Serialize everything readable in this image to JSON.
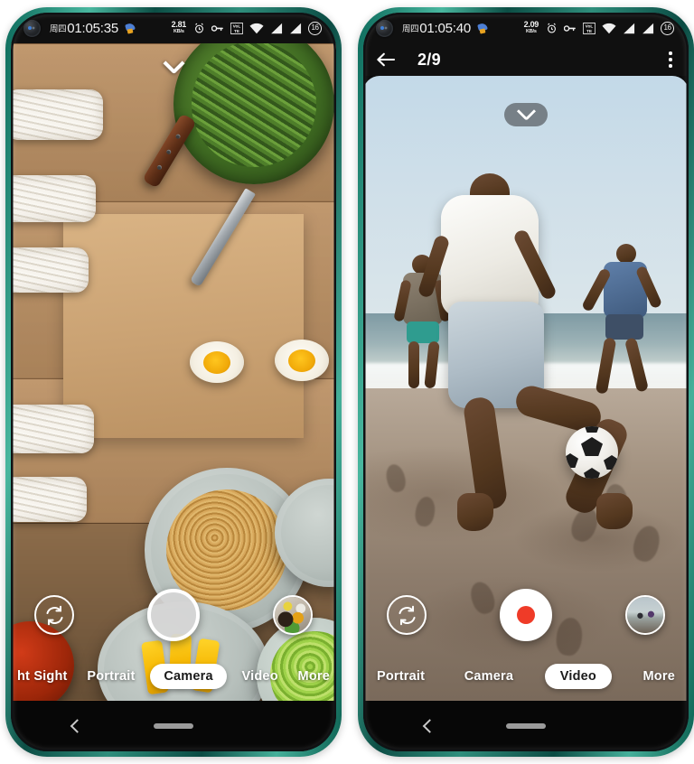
{
  "phones": {
    "left": {
      "status_bar": {
        "day": "周四",
        "time": "01:05:35",
        "app_icon": "bird-app-icon",
        "net_speed_value": "2.81",
        "net_speed_unit": "KB/s",
        "icons": [
          "alarm-icon",
          "key-icon",
          "volte-icon",
          "wifi-icon",
          "signal-1-icon",
          "signal-2-icon"
        ],
        "battery_level": "16"
      },
      "viewfinder": {
        "scene_description": "noodle-and-food-flatlay",
        "expand_button": "chevron-down-icon"
      },
      "controls": {
        "flip_camera": "camera-flip-icon",
        "shutter": "photo-shutter-button",
        "thumbnail": "gallery-thumbnail-spices"
      },
      "modes": [
        {
          "label": "ht Sight",
          "active": false
        },
        {
          "label": "Portrait",
          "active": false
        },
        {
          "label": "Camera",
          "active": true
        },
        {
          "label": "Video",
          "active": false
        },
        {
          "label": "More",
          "active": false
        }
      ],
      "navbar": {
        "back": "back-chevron-icon",
        "home": "home-pill-icon"
      }
    },
    "right": {
      "status_bar": {
        "day": "周四",
        "time": "01:05:40",
        "app_icon": "bird-app-icon",
        "net_speed_value": "2.09",
        "net_speed_unit": "KB/s",
        "icons": [
          "alarm-icon",
          "key-icon",
          "volte-icon",
          "wifi-icon",
          "signal-1-icon",
          "signal-2-icon"
        ],
        "battery_level": "16"
      },
      "header": {
        "back_icon": "back-arrow-icon",
        "title": "2/9",
        "menu_icon": "overflow-menu-icon"
      },
      "viewfinder": {
        "scene_description": "beach-football-players",
        "expand_button": "chevron-down-icon"
      },
      "controls": {
        "flip_camera": "camera-flip-icon",
        "shutter": "video-record-button",
        "thumbnail": "gallery-thumbnail-beach"
      },
      "modes": [
        {
          "label": "Portrait",
          "active": false
        },
        {
          "label": "Camera",
          "active": false
        },
        {
          "label": "Video",
          "active": true
        },
        {
          "label": "More",
          "active": false
        }
      ],
      "navbar": {
        "back": "back-chevron-icon",
        "home": "home-pill-icon"
      }
    }
  },
  "colors": {
    "frame": "#1f7f6c",
    "record_red": "#ef3b28",
    "active_pill": "#ffffff",
    "status_bg": "#101010"
  }
}
